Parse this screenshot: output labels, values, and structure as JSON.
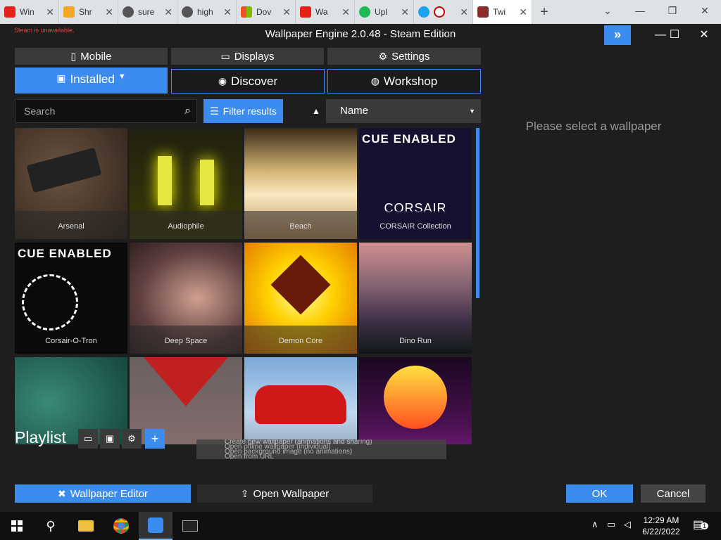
{
  "browser": {
    "tabs": [
      {
        "title": "Win",
        "color": "#e62117"
      },
      {
        "title": "Shr",
        "color": "#f5a623"
      },
      {
        "title": "sure",
        "color": "#555555"
      },
      {
        "title": "high",
        "color": "#555555"
      },
      {
        "title": "Dov",
        "color": "#f25022"
      },
      {
        "title": "Wa",
        "color": "#e62117"
      },
      {
        "title": "Upl",
        "color": "#1db954"
      },
      {
        "title": "",
        "color": "#1da1f2"
      },
      {
        "title": "Twi",
        "color": "#8b2b2b"
      }
    ],
    "new_tab_label": "+",
    "controls": {
      "dropdown": "⌄",
      "minimize": "—",
      "restore": "❐",
      "close": "✕"
    }
  },
  "app": {
    "title": "Wallpaper Engine 2.0.48 - Steam Edition",
    "steam_warning": "Steam is unavailable.",
    "expand_icon": "»",
    "window_controls": {
      "minimize": "—",
      "maximize": "☐",
      "close": "✕"
    },
    "top_buttons": {
      "mobile": "Mobile",
      "displays": "Displays",
      "settings": "Settings"
    },
    "tabs": {
      "installed": "Installed",
      "discover": "Discover",
      "workshop": "Workshop"
    },
    "search": {
      "placeholder": "Search"
    },
    "filter_label": "Filter results",
    "sort": {
      "direction": "▲",
      "value": "Name",
      "caret": "▼"
    },
    "wallpapers": [
      {
        "name": "Arsenal"
      },
      {
        "name": "Audiophile"
      },
      {
        "name": "Beach"
      },
      {
        "name": "CORSAIR Collection",
        "badge": "CUE ENABLED",
        "brand": "CORSAIR"
      },
      {
        "name": "Corsair-O-Tron",
        "badge": "CUE ENABLED"
      },
      {
        "name": "Deep Space"
      },
      {
        "name": "Demon Core"
      },
      {
        "name": "Dino Run"
      },
      {
        "name": ""
      },
      {
        "name": ""
      },
      {
        "name": ""
      },
      {
        "name": ""
      }
    ],
    "right_panel_message": "Please select a wallpaper",
    "playlist": {
      "title": "Playlist"
    },
    "context_menu": [
      "Create new wallpaper (animations and sharing)",
      "Open offline wallpaper (individual)",
      "Open background image (no animations)",
      "Open from URL"
    ],
    "bottom": {
      "wallpaper_editor": "Wallpaper Editor",
      "open_wallpaper": "Open Wallpaper",
      "ok": "OK",
      "cancel": "Cancel"
    }
  },
  "taskbar": {
    "time": "12:29 AM",
    "date": "6/22/2022",
    "notification_count": "1"
  },
  "colors": {
    "accent": "#3c8cf0",
    "background": "#1e1e1e"
  }
}
